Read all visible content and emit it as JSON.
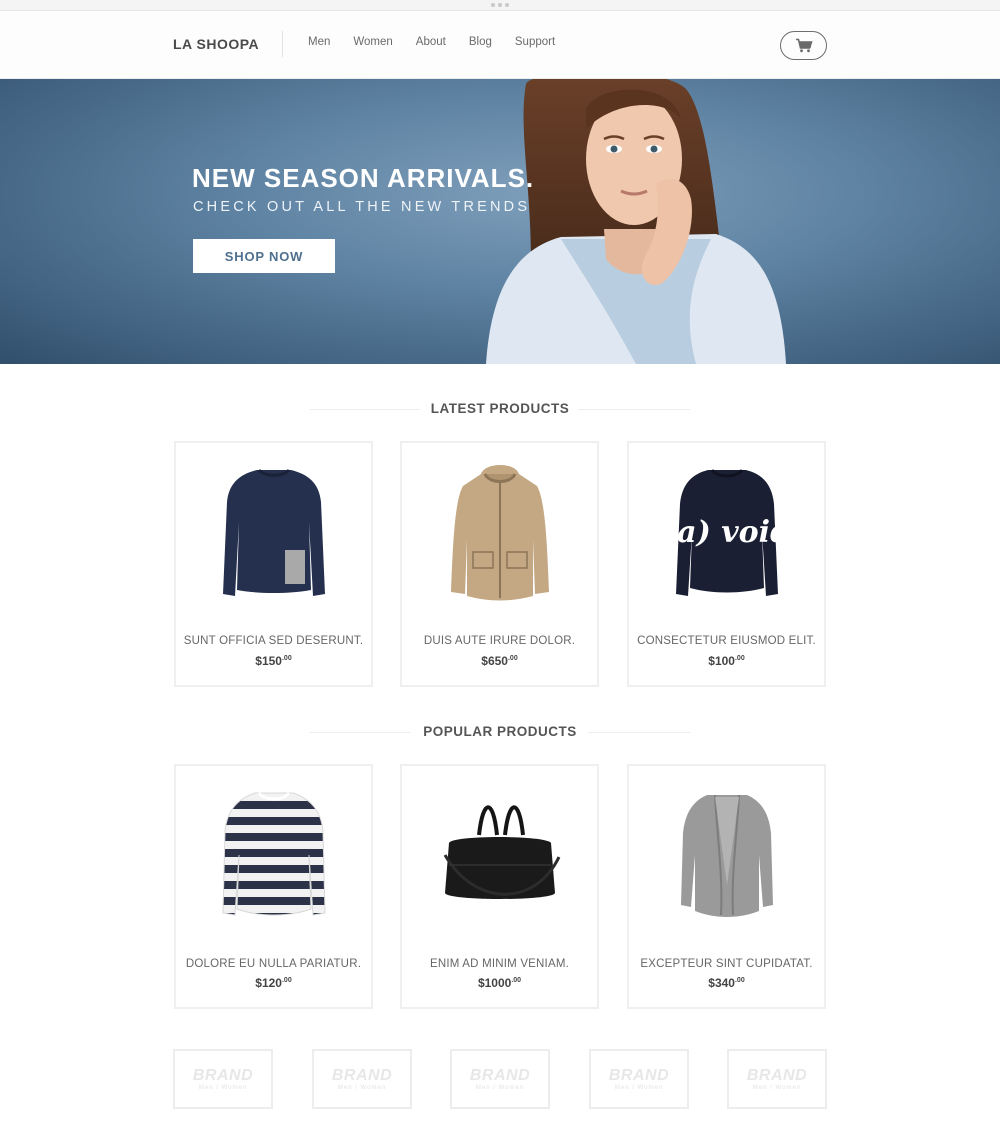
{
  "header": {
    "logo": "LA SHOOPA",
    "nav": [
      "Men",
      "Women",
      "About",
      "Blog",
      "Support"
    ]
  },
  "hero": {
    "title": "NEW SEASON ARRIVALS.",
    "subtitle": "CHECK OUT ALL THE NEW TRENDS",
    "button": "SHOP NOW"
  },
  "latest": {
    "title": "LATEST PRODUCTS",
    "items": [
      {
        "name": "SUNT OFFICIA SED DESERUNT.",
        "price": "$150",
        "cents": ".00",
        "icon": "navy-sweater-icon"
      },
      {
        "name": "DUIS AUTE IRURE DOLOR.",
        "price": "$650",
        "cents": ".00",
        "icon": "beige-parka-icon"
      },
      {
        "name": "CONSECTETUR EIUSMOD ELIT.",
        "price": "$100",
        "cents": ".00",
        "icon": "void-sweatshirt-icon"
      }
    ]
  },
  "popular": {
    "title": "POPULAR PRODUCTS",
    "items": [
      {
        "name": "DOLORE EU NULLA PARIATUR.",
        "price": "$120",
        "cents": ".00",
        "icon": "striped-top-icon"
      },
      {
        "name": "ENIM AD MINIM VENIAM.",
        "price": "$1000",
        "cents": ".00",
        "icon": "leather-bag-icon"
      },
      {
        "name": "EXCEPTEUR SINT CUPIDATAT.",
        "price": "$340",
        "cents": ".00",
        "icon": "grey-cardigan-icon"
      }
    ]
  },
  "sweater_text": "(a) void",
  "brands": [
    {
      "name": "BRAND",
      "tagline": "Men / Women"
    },
    {
      "name": "BRAND",
      "tagline": "Men / Women"
    },
    {
      "name": "BRAND",
      "tagline": "Men / Women"
    },
    {
      "name": "BRAND",
      "tagline": "Men / Women"
    },
    {
      "name": "BRAND",
      "tagline": "Men / Women"
    }
  ],
  "colors": {
    "hero_blue": "#5f83a3",
    "button_text": "#4f6f8e",
    "text_dark": "#555555"
  }
}
